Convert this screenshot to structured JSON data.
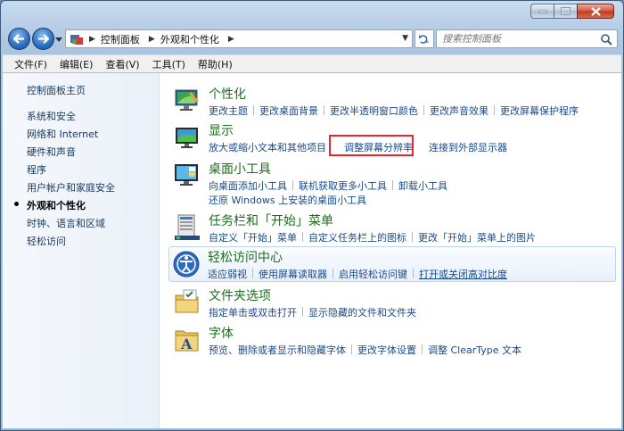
{
  "window": {
    "caption_buttons": [
      "minimize",
      "maximize",
      "close"
    ]
  },
  "address": {
    "segments": [
      "控制面板",
      "外观和个性化"
    ],
    "search_placeholder": "搜索控制面板"
  },
  "menu": [
    "文件(F)",
    "编辑(E)",
    "查看(V)",
    "工具(T)",
    "帮助(H)"
  ],
  "sidebar": {
    "home": "控制面板主页",
    "items": [
      {
        "label": "系统和安全",
        "active": false
      },
      {
        "label": "网络和 Internet",
        "active": false
      },
      {
        "label": "硬件和声音",
        "active": false
      },
      {
        "label": "程序",
        "active": false
      },
      {
        "label": "用户帐户和家庭安全",
        "active": false
      },
      {
        "label": "外观和个性化",
        "active": true
      },
      {
        "label": "时钟、语言和区域",
        "active": false
      },
      {
        "label": "轻松访问",
        "active": false
      }
    ]
  },
  "categories": [
    {
      "title": "个性化",
      "icon": "personalization-icon",
      "links": [
        "更改主题",
        "更改桌面背景",
        "更改半透明窗口颜色",
        "更改声音效果",
        "更改屏幕保护程序"
      ]
    },
    {
      "title": "显示",
      "icon": "display-icon",
      "links": [
        "放大或缩小文本和其他项目",
        "调整屏幕分辨率",
        "连接到外部显示器"
      ]
    },
    {
      "title": "桌面小工具",
      "icon": "gadgets-icon",
      "links": [
        "向桌面添加小工具",
        "联机获取更多小工具",
        "卸载小工具"
      ],
      "links2": [
        "还原 Windows 上安装的桌面小工具"
      ]
    },
    {
      "title": "任务栏和「开始」菜单",
      "icon": "taskbar-icon",
      "links": [
        "自定义「开始」菜单",
        "自定义任务栏上的图标",
        "更改「开始」菜单上的图片"
      ]
    },
    {
      "title": "轻松访问中心",
      "icon": "ease-of-access-icon",
      "links": [
        "适应弱视",
        "使用屏幕读取器",
        "启用轻松访问键",
        "打开或关闭高对比度"
      ]
    },
    {
      "title": "文件夹选项",
      "icon": "folder-options-icon",
      "links": [
        "指定单击或双击打开",
        "显示隐藏的文件和文件夹"
      ]
    },
    {
      "title": "字体",
      "icon": "fonts-icon",
      "links": [
        "预览、删除或者显示和隐藏字体",
        "更改字体设置",
        "调整 ClearType 文本"
      ]
    }
  ],
  "highlight_color": "#e8262b"
}
